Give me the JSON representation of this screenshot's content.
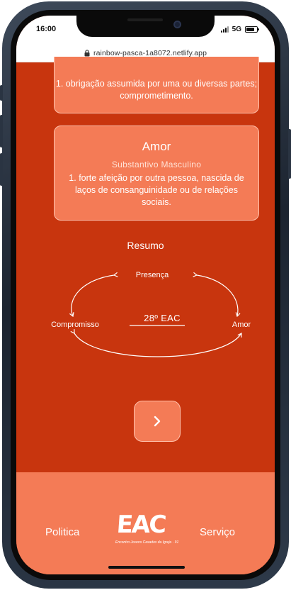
{
  "status_bar": {
    "time": "16:00",
    "network": "5G"
  },
  "browser": {
    "url": "rainbow-pasca-1a8072.netlify.app"
  },
  "cards": [
    {
      "definition": "1. obrigação assumida por uma ou diversas partes; comprometimento."
    },
    {
      "word": "Amor",
      "word_class": "Substantivo Masculino",
      "definition": "1. forte afeição por outra pessoa, nascida de laços de consanguinidade ou de relações sociais."
    }
  ],
  "resumo": {
    "title": "Resumo",
    "top_node": "Presença",
    "left_node": "Compromisso",
    "right_node": "Amor",
    "center_label": "28º EAC"
  },
  "next_button": {
    "icon": "chevron-right-icon"
  },
  "footer": {
    "left_link": "Politica",
    "right_link": "Serviço",
    "logo_text": "EAC",
    "logo_subtitle": "Encontro Jovens Casados da Igreja · 91"
  },
  "colors": {
    "background": "#c8350e",
    "card": "#f47b56",
    "card_border": "#ffc0ab",
    "text": "#ffffff"
  }
}
